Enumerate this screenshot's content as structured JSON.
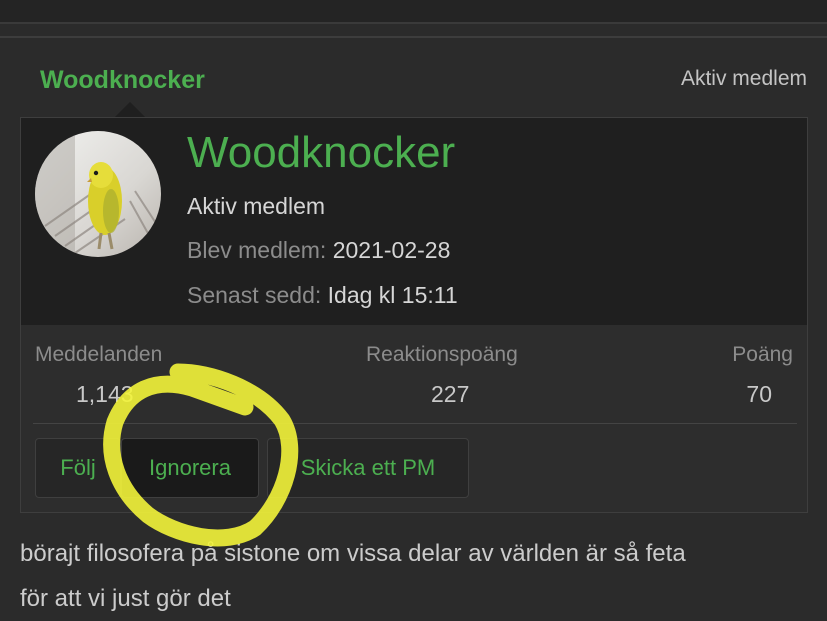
{
  "header": {
    "username": "Woodknocker",
    "role": "Aktiv medlem"
  },
  "profile": {
    "name": "Woodknocker",
    "role": "Aktiv medlem",
    "joined_label": "Blev medlem:",
    "joined_value": "2021-02-28",
    "last_seen_label": "Senast sedd:",
    "last_seen_value": "Idag kl 15:11",
    "avatar_icon": "parakeet-avatar",
    "accent_color": "#4caf50"
  },
  "stats": {
    "messages_label": "Meddelanden",
    "messages_value": "1,143",
    "reactions_label": "Reaktionspoäng",
    "reactions_value": "227",
    "points_label": "Poäng",
    "points_value": "70"
  },
  "actions": {
    "follow": "Följ",
    "ignore": "Ignorera",
    "send_pm": "Skicka ett PM"
  },
  "post": {
    "line1": "börajt filosofera på sistone om vissa delar av världen är så feta",
    "line2": "för att vi just gör det"
  },
  "annotation": {
    "color": "#f3f43a"
  }
}
